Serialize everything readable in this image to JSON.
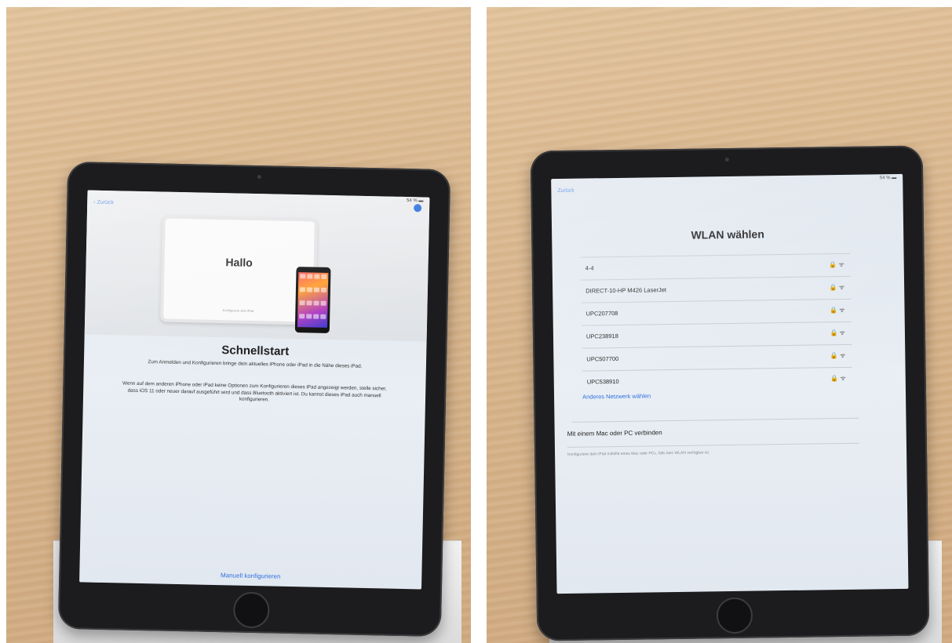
{
  "left_photo": {
    "screen": {
      "status": "54 % ▬",
      "back": "‹ Zurück",
      "hero_title": "Hallo",
      "hero_foot": "Konfiguriere dein iPad",
      "title": "Schnellstart",
      "paragraph1": "Zum Anmelden und Konfigurieren bringe dein aktuelles iPhone oder iPad in die Nähe dieses iPad.",
      "paragraph2": "Wenn auf dem anderen iPhone oder iPad keine Optionen zum Konfigurieren dieses iPad angezeigt werden, stelle sicher, dass iOS 11 oder neuer darauf ausgeführt wird und dass Bluetooth aktiviert ist. Du kannst dieses iPad auch manuell konfigurieren.",
      "manual_button": "Manuell konfigurieren"
    }
  },
  "right_photo": {
    "screen": {
      "status": "54 % ▬",
      "back": "Zurück",
      "title": "WLAN wählen",
      "networks": [
        {
          "name": "4-4",
          "icons": "🔒 ᯤ"
        },
        {
          "name": "DIRECT-10-HP M426 LaserJet",
          "icons": "🔒 ᯤ"
        },
        {
          "name": "UPC207708",
          "icons": "🔒 ᯤ"
        },
        {
          "name": "UPC238918",
          "icons": "🔒 ᯤ"
        },
        {
          "name": "UPC507700",
          "icons": "🔒 ᯤ"
        },
        {
          "name": "UPC538910",
          "icons": "🔒 ᯤ"
        }
      ],
      "other_network": "Anderes Netzwerk wählen",
      "mac_title": "Mit einem Mac oder PC verbinden",
      "mac_hint": "Konfiguriere dein iPad mithilfe eines Mac oder PCs, falls kein WLAN verfügbar ist."
    }
  },
  "colors": {
    "accent_blue": "#2f6fe0",
    "wood": "#d8b58c",
    "bezel": "#1c1c1e"
  }
}
